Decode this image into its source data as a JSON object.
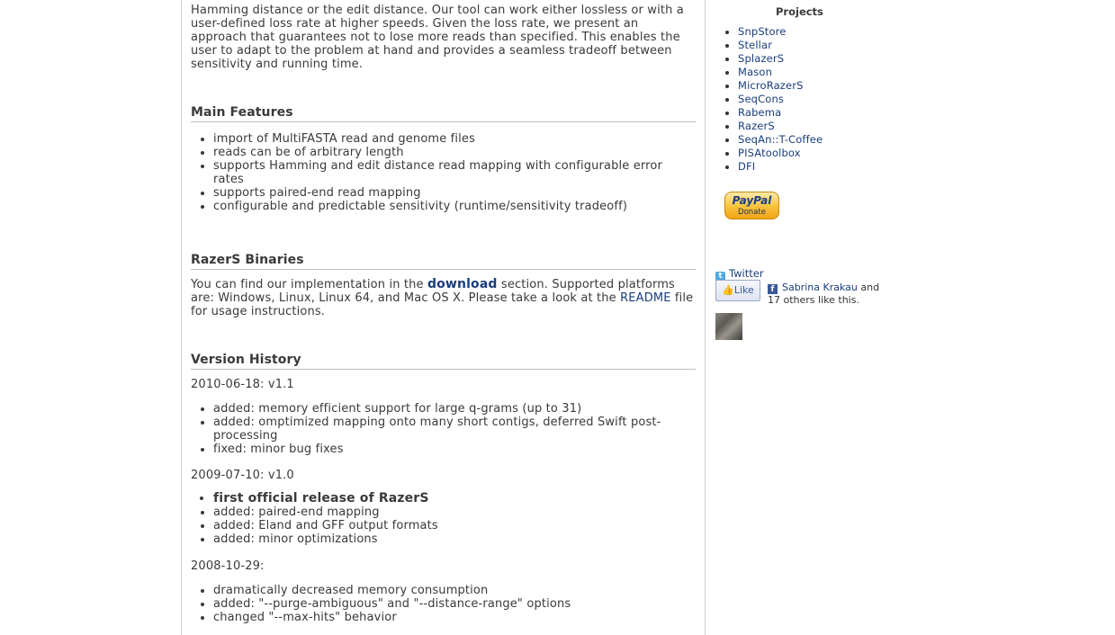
{
  "intro_text": "Hamming distance or the edit distance. Our tool can work either lossless or with a\nuser-defined loss rate at higher speeds. Given the loss rate, we present an\napproach that guarantees not to lose more reads than specified. This enables the\nuser to adapt to the problem at hand and provides a seamless tradeoff between\nsensitivity and running time.",
  "main_features": {
    "heading": "Main Features",
    "items": [
      "import of MultiFASTA read and genome files",
      "reads can be of arbitrary length",
      "supports Hamming and edit distance read mapping with configurable error rates",
      "supports paired-end read mapping",
      "configurable and predictable sensitivity (runtime/sensitivity tradeoff)"
    ]
  },
  "binaries": {
    "heading": "RazerS Binaries",
    "text_1": "You can find our implementation in the",
    "download_link": "download",
    "text_2": "section. Supported platforms are: Windows, Linux, Linux 64, and Mac OS X. Please take a look at the",
    "readme_link": "README",
    "text_3": "file for usage instructions."
  },
  "version_history": {
    "heading": "Version History",
    "releases": [
      {
        "label": "2010-06-18: v1.1",
        "items": [
          "added: memory efficient support for large q-grams (up to 31)",
          "added: omptimized mapping onto many short contigs, deferred Swift post-processing",
          "fixed: minor bug fixes"
        ]
      },
      {
        "label": "2009-07-10: v1.0",
        "highlight": "first official release of RazerS",
        "items": [
          "added: paired-end mapping",
          "added: Eland and GFF output formats",
          "added: minor optimizations"
        ]
      },
      {
        "label": "2008-10-29:",
        "items": [
          "dramatically decreased memory consumption",
          "added: \"--purge-ambiguous\" and \"--distance-range\" options",
          "changed \"--max-hits\" behavior"
        ]
      }
    ]
  },
  "sidebar": {
    "projects_title": "Projects",
    "projects": [
      "SnpStore",
      "Stellar",
      "SplazerS",
      "Mason",
      "MicroRazerS",
      "SeqCons",
      "Rabema",
      "RazerS",
      "SeqAn::T-Coffee",
      "PISAtoolbox",
      "DFI"
    ],
    "paypal_logo": "PayPal",
    "paypal_donate": "Donate",
    "twitter_label": "Twitter",
    "like_label": "Like",
    "fb_user": "Sabrina Krakau",
    "fb_and": "and",
    "fb_others": "17 others like this."
  },
  "colors": {
    "link": "#1a3e7a",
    "text": "#3a3a3a",
    "rule": "#bdbdbd"
  }
}
